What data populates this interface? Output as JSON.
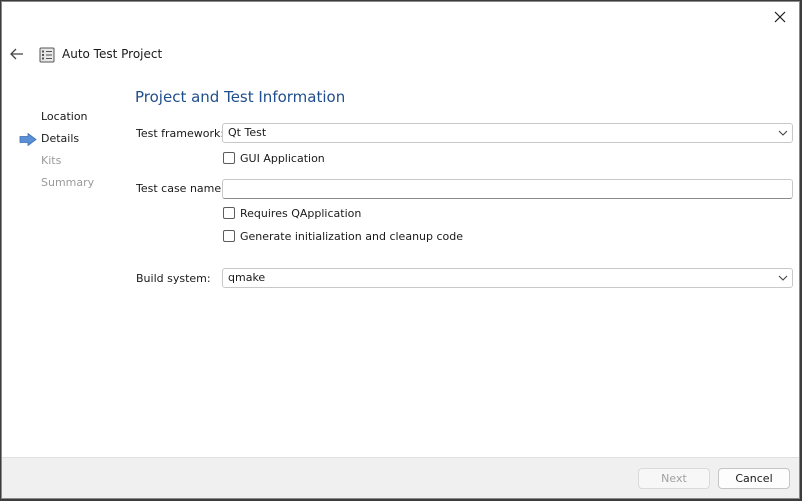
{
  "window": {
    "title": "Auto Test Project"
  },
  "wizard": {
    "steps": [
      {
        "label": "Location",
        "state": "done"
      },
      {
        "label": "Details",
        "state": "current"
      },
      {
        "label": "Kits",
        "state": "pending"
      },
      {
        "label": "Summary",
        "state": "pending"
      }
    ]
  },
  "page": {
    "title": "Project and Test Information"
  },
  "form": {
    "framework_label": "Test framework:",
    "framework_value": "Qt Test",
    "gui_app_label": "GUI Application",
    "gui_app_checked": false,
    "test_case_label": "Test case name:",
    "test_case_value": "",
    "requires_qapp_label": "Requires QApplication",
    "requires_qapp_checked": false,
    "gen_init_label": "Generate initialization and cleanup code",
    "gen_init_checked": false,
    "build_system_label": "Build system:",
    "build_system_value": "qmake"
  },
  "buttons": {
    "next_label": "Next",
    "next_enabled": false,
    "cancel_label": "Cancel"
  },
  "colors": {
    "title_blue": "#1f4e8c",
    "step_arrow": "#5b8fd6",
    "disabled_text": "#9a9a9a"
  },
  "icons": {
    "close": "close-icon",
    "back": "back-arrow-icon",
    "wizard": "checklist-icon",
    "current_step": "step-arrow-icon",
    "dropdown": "chevron-down-icon"
  }
}
